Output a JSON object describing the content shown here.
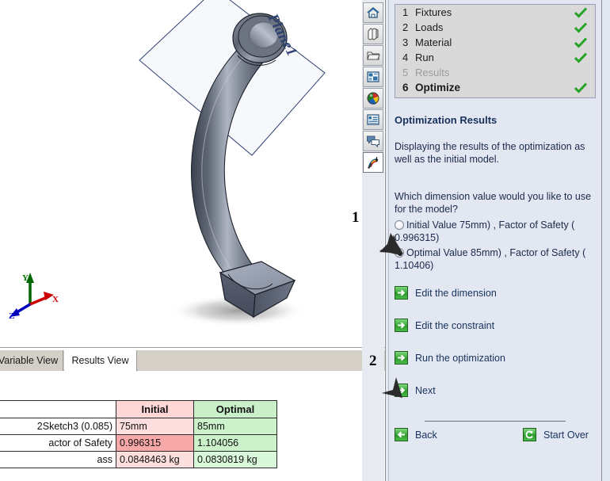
{
  "graphics": {
    "plane_label": "Plane1",
    "triad": {
      "x": "X",
      "y": "Y",
      "z": "Z"
    }
  },
  "bottom_pane": {
    "tabs": [
      {
        "label": "Variable View",
        "active": false
      },
      {
        "label": "Results View",
        "active": true
      },
      {
        "label": "",
        "active": false
      }
    ],
    "table": {
      "headers": [
        "",
        "Initial",
        "Optimal"
      ],
      "rows": [
        {
          "label": "2Sketch3 (0.085)",
          "initial": "75mm",
          "optimal": "85mm"
        },
        {
          "label": "actor of Safety",
          "initial": "0.996315",
          "optimal": "1.104056"
        },
        {
          "label": "ass",
          "initial": "0.0848463 kg",
          "optimal": "0.0830819 kg"
        }
      ]
    }
  },
  "icon_rail": {
    "items": [
      {
        "name": "home-icon",
        "title": "SOLIDWORKS Resources",
        "selected": false
      },
      {
        "name": "design-library-icon",
        "title": "Design Library",
        "selected": false
      },
      {
        "name": "file-explorer-icon",
        "title": "File Explorer",
        "selected": false
      },
      {
        "name": "view-palette-icon",
        "title": "View Palette",
        "selected": false
      },
      {
        "name": "appearances-icon",
        "title": "Appearances, Scenes and Decals",
        "selected": false
      },
      {
        "name": "custom-properties-icon",
        "title": "Custom Properties",
        "selected": false
      },
      {
        "name": "solidworks-forum-icon",
        "title": "SOLIDWORKS Forum",
        "selected": false
      },
      {
        "name": "simulation-icon",
        "title": "Simulation",
        "selected": true
      }
    ]
  },
  "task_panel": {
    "steps": [
      {
        "num": "1",
        "label": "Fixtures",
        "state": "done"
      },
      {
        "num": "2",
        "label": "Loads",
        "state": "done"
      },
      {
        "num": "3",
        "label": "Material",
        "state": "done"
      },
      {
        "num": "4",
        "label": "Run",
        "state": "done"
      },
      {
        "num": "5",
        "label": "Results",
        "state": "disabled"
      },
      {
        "num": "6",
        "label": "Optimize",
        "state": "current"
      }
    ],
    "title": "Optimization Results",
    "description": "Displaying the results of the optimization as well as the initial model.",
    "question": "Which dimension value would you like to use for the model?",
    "options": [
      {
        "label": "Initial Value 75mm) , Factor of Safety ( 0.996315)",
        "selected": false
      },
      {
        "label": "Optimal Value 85mm) , Factor of Safety ( 1.10406)",
        "selected": true
      }
    ],
    "actions": [
      {
        "label": "Edit the dimension",
        "icon": "arrow-right-icon"
      },
      {
        "label": "Edit the constraint",
        "icon": "arrow-right-icon"
      },
      {
        "label": "Run the optimization",
        "icon": "arrow-right-icon"
      },
      {
        "label": "Next",
        "icon": "arrow-right-icon"
      }
    ],
    "footer": [
      {
        "label": "Back",
        "icon": "arrow-left-icon"
      },
      {
        "label": "Start Over",
        "icon": "refresh-icon"
      }
    ]
  },
  "annotations": [
    {
      "number": "1",
      "target": "optimal-value-radio"
    },
    {
      "number": "2",
      "target": "next-action"
    }
  ],
  "colors": {
    "panel_background": "#e3e7f2",
    "step_list_background": "#d9d9d9",
    "link_text": "#16325c",
    "green_check": "#27a327",
    "initial_header": "#ffd7d7",
    "optimal_header": "#c9f0c9",
    "initial_highlight": "#f7a8a8",
    "optimal_cell": "#ccf2cc"
  }
}
